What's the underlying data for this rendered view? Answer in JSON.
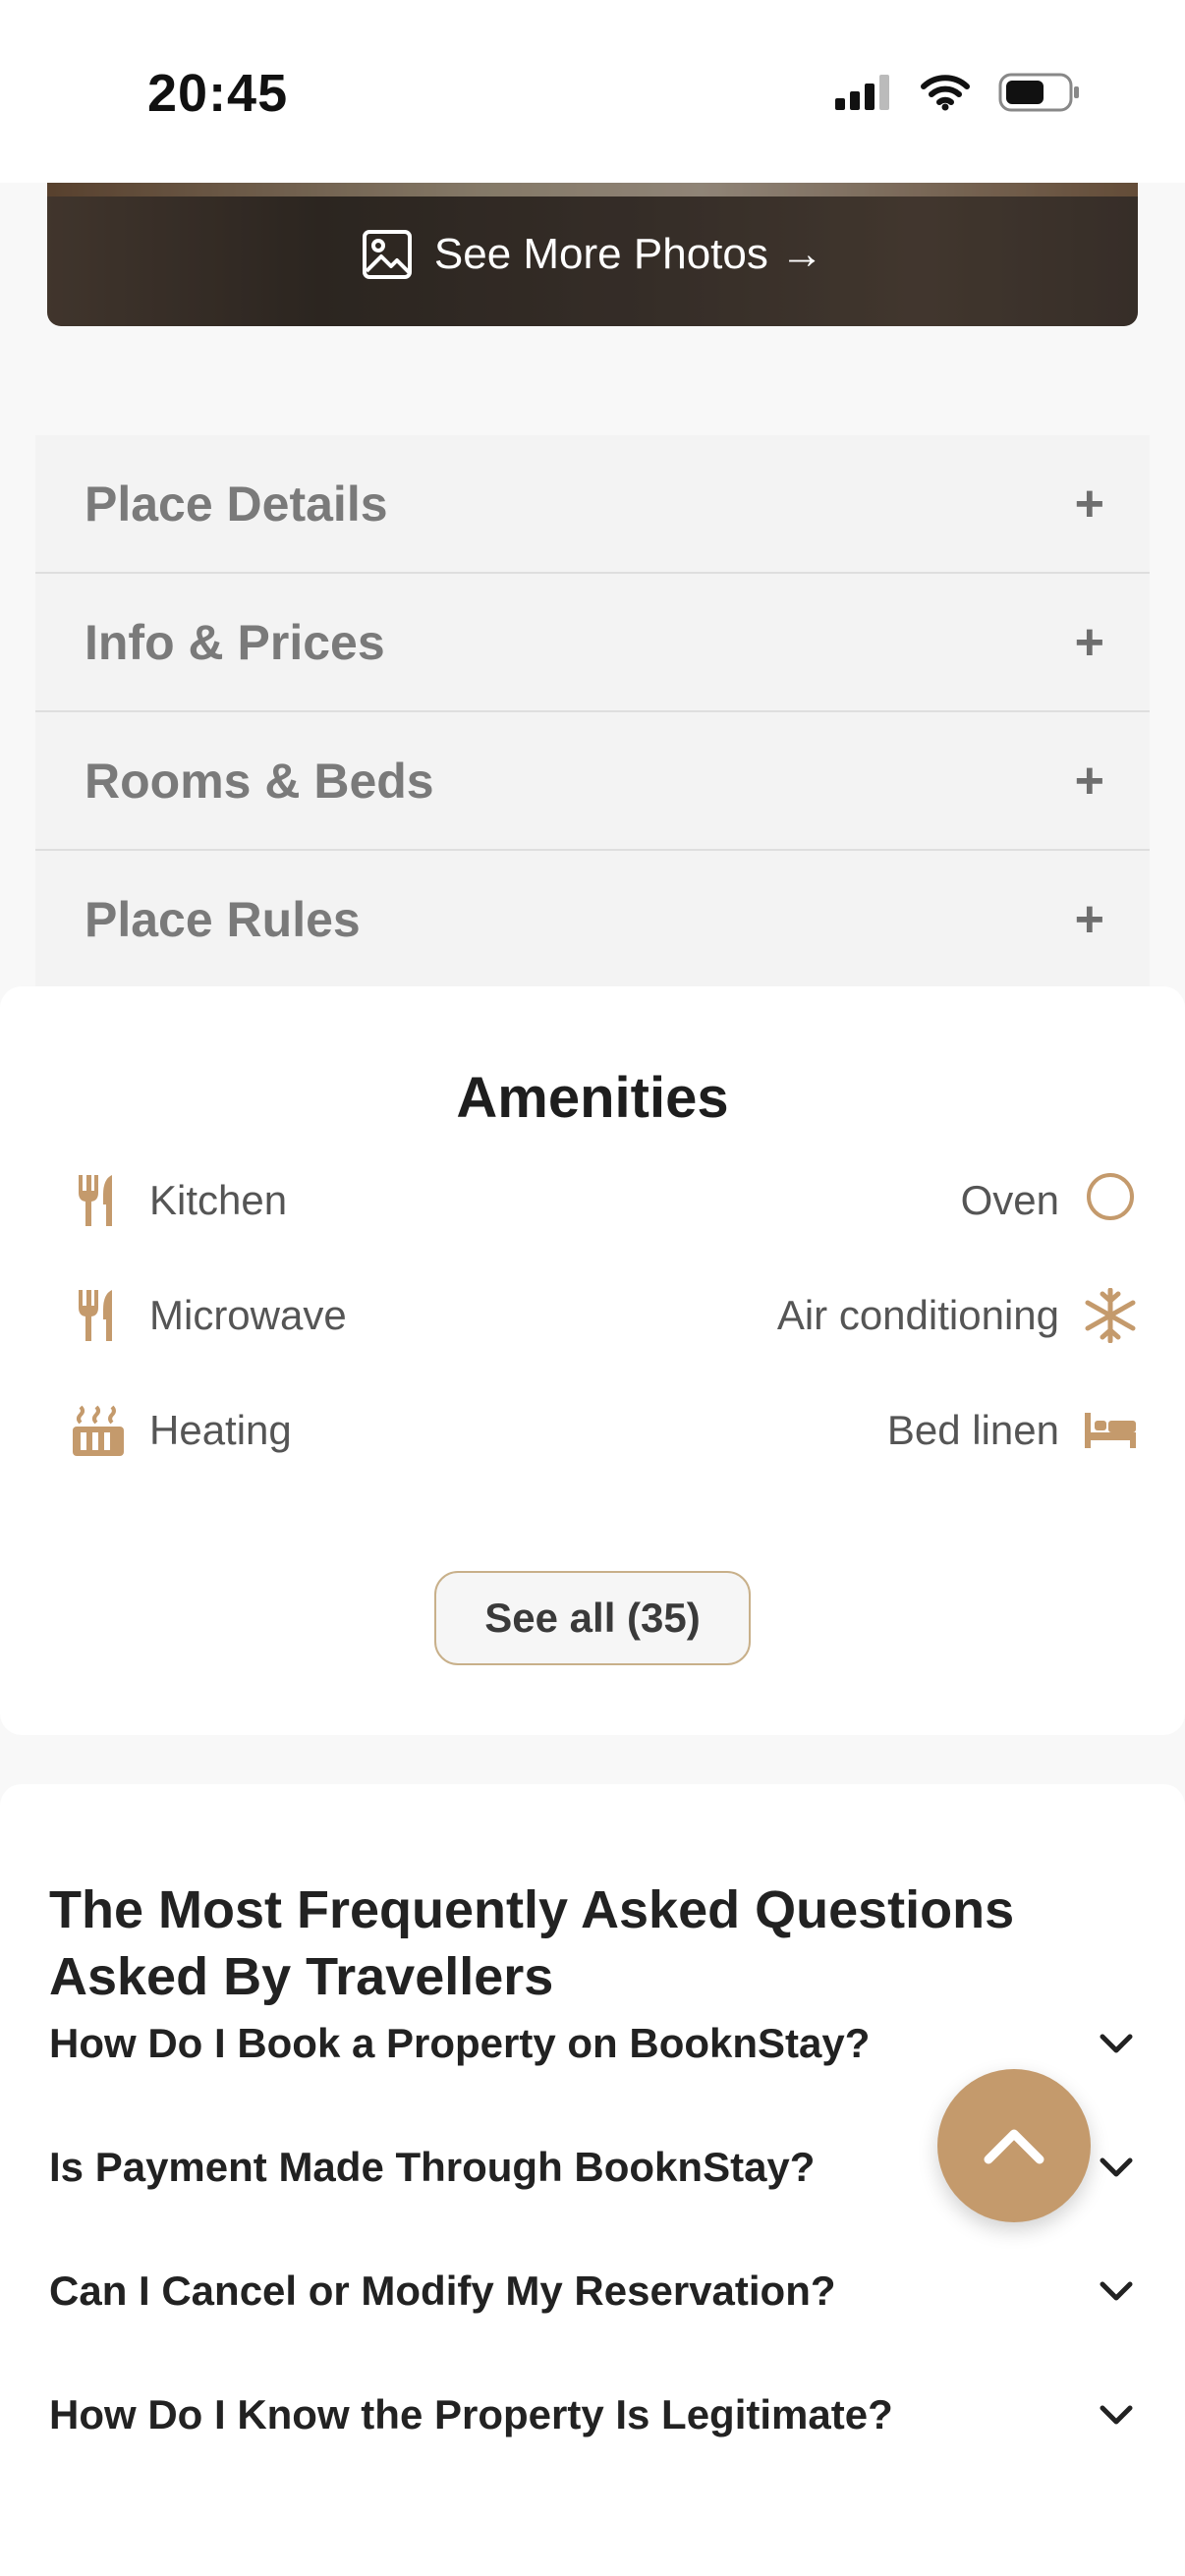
{
  "status_bar": {
    "time": "20:45"
  },
  "photos": {
    "button_label": "See More Photos →"
  },
  "accordion": [
    {
      "label": "Place Details",
      "toggle": "+"
    },
    {
      "label": "Info & Prices",
      "toggle": "+"
    },
    {
      "label": "Rooms & Beds",
      "toggle": "+"
    },
    {
      "label": "Place Rules",
      "toggle": "+"
    }
  ],
  "amenities": {
    "title": "Amenities",
    "left": [
      {
        "label": "Kitchen",
        "icon": "utensils-icon"
      },
      {
        "label": "Microwave",
        "icon": "utensils-icon"
      },
      {
        "label": "Heating",
        "icon": "heater-icon"
      }
    ],
    "right": [
      {
        "label": "Oven",
        "icon": "circle-icon"
      },
      {
        "label": "Air conditioning",
        "icon": "snowflake-icon"
      },
      {
        "label": "Bed linen",
        "icon": "bed-icon"
      }
    ],
    "see_all_label": "See all (35)",
    "accent_color": "#c49a6c"
  },
  "faq": {
    "title": "The Most Frequently Asked Questions Asked By Travellers",
    "questions": [
      "How Do I Book a Property on BooknStay?",
      "Is Payment Made Through BooknStay?",
      "Can I Cancel or Modify My Reservation?",
      "How Do I Know the Property Is Legitimate?"
    ]
  }
}
